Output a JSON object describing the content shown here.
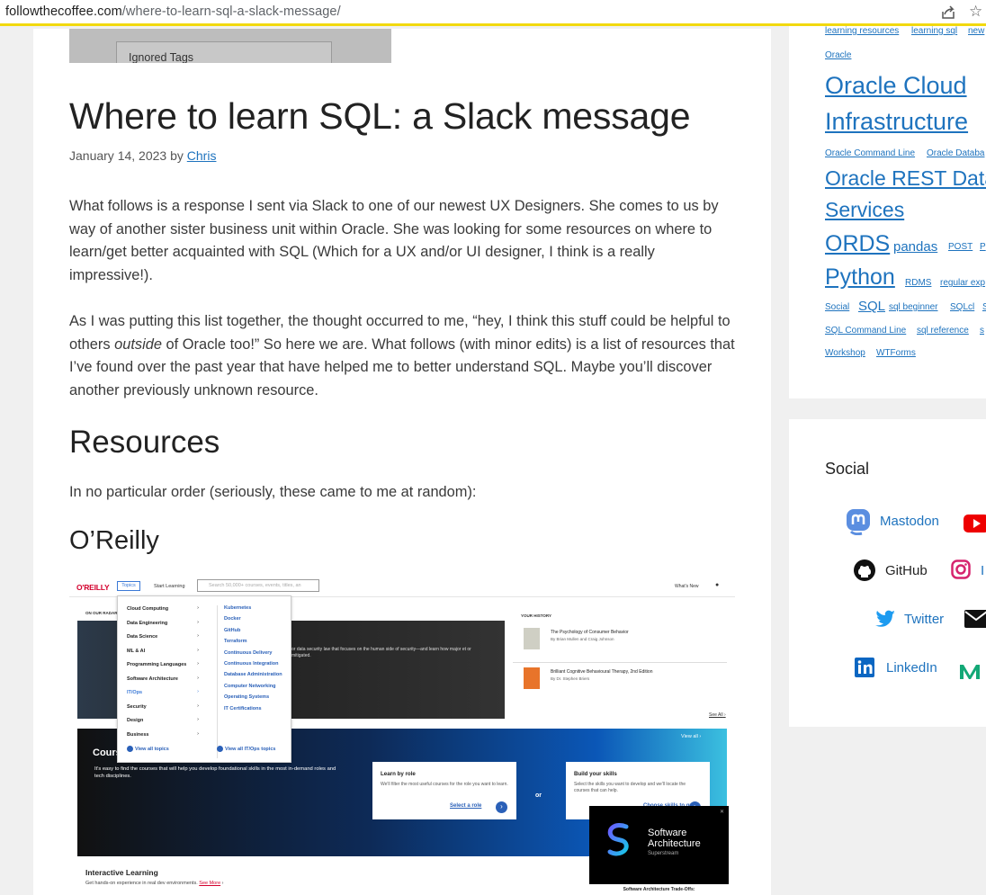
{
  "browser": {
    "url_domain": "followthecoffee.com",
    "url_path": "/where-to-learn-sql-a-slack-message/"
  },
  "article": {
    "top_image_label": "Ignored Tags",
    "title": "Where to learn SQL: a Slack message",
    "date": "January 14, 2023",
    "by": "by",
    "author": "Chris",
    "para1": "What follows is a response I sent via Slack to one of our newest UX Designers. She comes to us by way of another sister business unit within Oracle. She was looking for some resources on where to learn/get better acquainted with SQL (Which for a UX and/or UI designer, I think is a really impressive!).",
    "para2_a": "As I was putting this list together, the thought occurred to me, “hey, I think this stuff could be helpful to others ",
    "para2_em": "outside",
    "para2_b": " of Oracle too!” So here we are. What follows (with minor edits) is a list of resources that I’ve found over the past year that have helped me to better understand SQL. Maybe you’ll discover another previously unknown resource.",
    "h2": "Resources",
    "para3": "In no particular order (seriously, these came to me at random):",
    "h3": "O’Reilly"
  },
  "oreilly": {
    "logo": "O'REILLY",
    "topics": "Topics",
    "start": "Start Learning",
    "search_placeholder": "Search 50,000+ courses, events, titles, an",
    "whats_new": "What's New",
    "radar": "ON OUR RADAR",
    "hero_text": "or data security law that focuses on the human side of security—and learn how major et or mitigated.",
    "menu_col1": [
      "Cloud Computing",
      "Data Engineering",
      "Data Science",
      "ML & AI",
      "Programming Languages",
      "Software Architecture",
      "IT/Ops",
      "Security",
      "Design",
      "Business"
    ],
    "menu_col2": [
      "Kubernetes",
      "Docker",
      "GitHub",
      "Terraform",
      "Continuous Delivery",
      "Continuous Integration",
      "Database Administration",
      "Computer Networking",
      "Operating Systems",
      "IT Certifications"
    ],
    "view_all_topics": "View all topics",
    "view_all_itops": "View all IT/Ops topics",
    "history_title": "YOUR HISTORY",
    "history": [
      {
        "title": "The Psychology of Consumer Behavior",
        "author": "By Brian Mullen and Craig Johnson",
        "color": "#cfcfc4"
      },
      {
        "title": "Brilliant Cognitive Behavioural Therapy, 2nd Edition",
        "author": "By Dr. Stephen Briers",
        "color": "#e8742a"
      }
    ],
    "see_all": "See All",
    "courses_title": "Cours",
    "courses_desc": "It's easy to find the courses that will help you develop foundational skills in the most in-demand roles and tech disciplines.",
    "view_all": "View all",
    "card1_title": "Learn by role",
    "card1_desc": "We'll filter the most useful courses for the role you want to learn.",
    "card1_link": "Select a role",
    "or": "or",
    "card2_title": "Build your skills",
    "card2_desc": "Select the skills you want to develop and we'll locate the courses that can help.",
    "card2_link": "Choose skills to grow",
    "interactive_title": "Interactive Learning",
    "interactive_desc": "Get hands-on experience in real dev environments.",
    "see_more": "See More",
    "ad_title": "Software Architecture",
    "ad_sub": "Superstream",
    "ad_footer": "Software Architecture Trade-Offs:"
  },
  "tags": [
    {
      "label": "learning resources",
      "size": 10
    },
    {
      "label": "learning sql",
      "size": 10
    },
    {
      "label": "new",
      "size": 10
    },
    {
      "label": "Oracle",
      "size": 10
    },
    {
      "label": "Oracle Cloud",
      "size": 27
    },
    {
      "label": "Infrastructure",
      "size": 27
    },
    {
      "label": "Oracle Command Line",
      "size": 10
    },
    {
      "label": "Oracle Databa",
      "size": 10
    },
    {
      "label": "Oracle REST Datab",
      "size": 23
    },
    {
      "label": "Services",
      "size": 23
    },
    {
      "label": "ORDS",
      "size": 25
    },
    {
      "label": "pandas",
      "size": 15
    },
    {
      "label": "POST",
      "size": 10
    },
    {
      "label": "P",
      "size": 10
    },
    {
      "label": "Python",
      "size": 25
    },
    {
      "label": "RDMS",
      "size": 10
    },
    {
      "label": "regular exp",
      "size": 10
    },
    {
      "label": "Social",
      "size": 10
    },
    {
      "label": "SQL",
      "size": 15
    },
    {
      "label": "sql beginner",
      "size": 10
    },
    {
      "label": "SQLcl",
      "size": 10
    },
    {
      "label": "S",
      "size": 10
    },
    {
      "label": "SQL Command Line",
      "size": 10
    },
    {
      "label": "sql reference",
      "size": 10
    },
    {
      "label": "s",
      "size": 10
    },
    {
      "label": "Workshop",
      "size": 10
    },
    {
      "label": "WTForms",
      "size": 10
    }
  ],
  "social": {
    "title": "Social",
    "links": [
      "Mastodon",
      "GitHub",
      "Twitter",
      "LinkedIn",
      "I"
    ]
  },
  "colors": {
    "link": "#1e73be",
    "accent_bar": "#f2d90f",
    "oreilly_red": "#d3002d"
  }
}
